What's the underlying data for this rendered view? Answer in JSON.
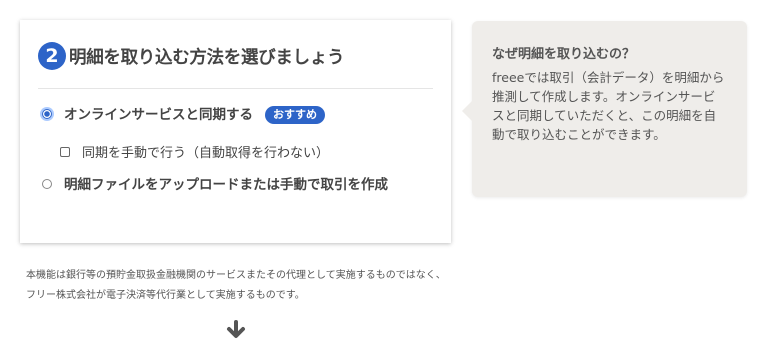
{
  "step": {
    "number": "2",
    "title": "明細を取り込む方法を選びましょう"
  },
  "options": {
    "online": {
      "label": "オンラインサービスと同期する",
      "badge": "おすすめ",
      "checked": true
    },
    "manual_sync": {
      "label": "同期を手動で行う（自動取得を行わない）",
      "checked": false
    },
    "upload": {
      "label": "明細ファイルをアップロードまたは手動で取引を作成",
      "checked": false
    }
  },
  "tooltip": {
    "title": "なぜ明細を取り込むの？",
    "body": "freeeでは取引（会計データ）を明細から推測して作成します。オンラインサービスと同期していただくと、この明細を自動で取り込むことができます。"
  },
  "disclaimer": "本機能は銀行等の預貯金取扱金融機関のサービスまたその代理として実施するものではなく、フリー株式会社が電子決済等代行業として実施するものです。",
  "icons": {
    "arrow": "arrow-down-icon"
  },
  "colors": {
    "accent": "#2d64c8",
    "tooltip_bg": "#efedea"
  }
}
